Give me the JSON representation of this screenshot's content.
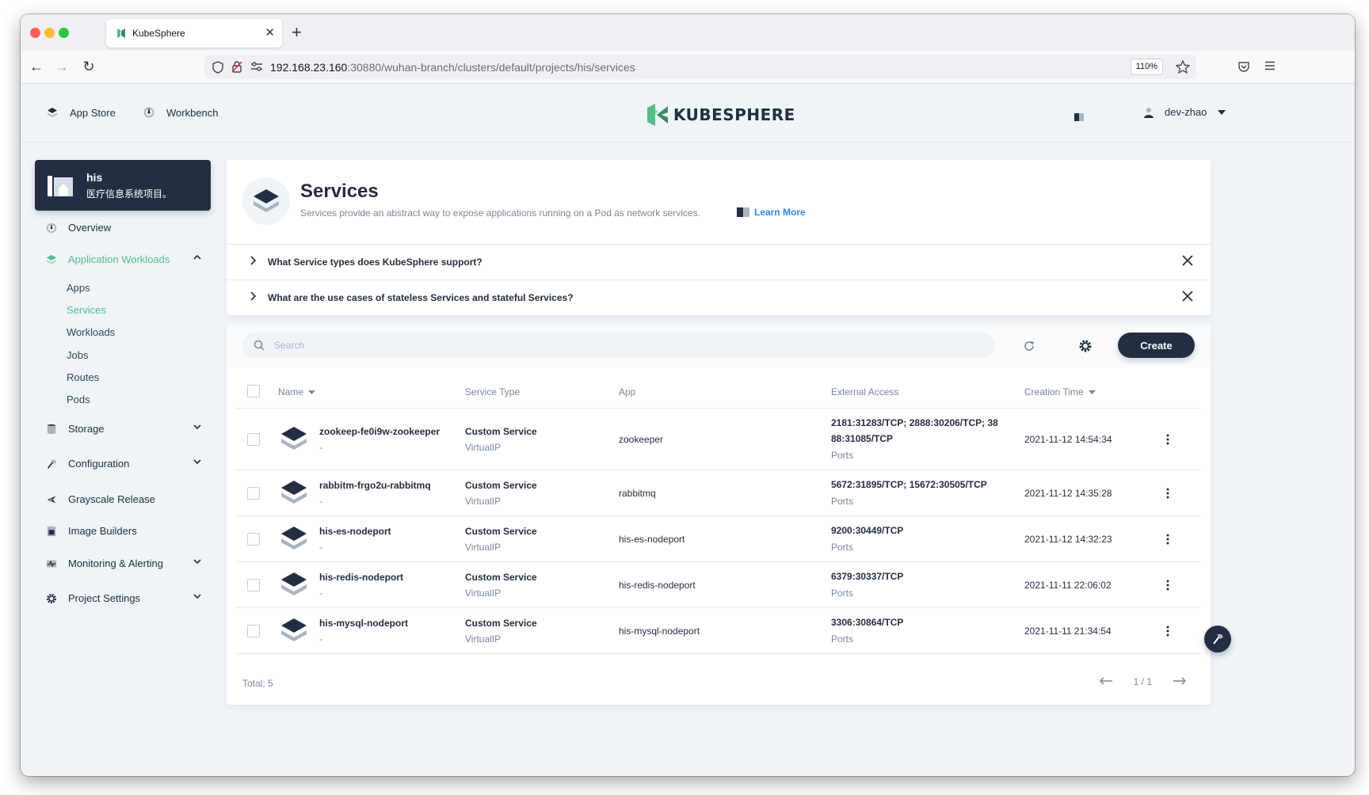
{
  "browser": {
    "tab_title": "KubeSphere",
    "url_host": "192.168.23.160",
    "url_rest": ":30880/wuhan-branch/clusters/default/projects/his/services",
    "zoom": "110%"
  },
  "header": {
    "app_store": "App Store",
    "workbench": "Workbench",
    "logo": "KUBESPHERE",
    "username": "dev-zhao"
  },
  "project": {
    "name": "his",
    "description": "医疗信息系统项目。"
  },
  "sidebar": {
    "overview": "Overview",
    "app_workloads": "Application Workloads",
    "sub_items": [
      "Apps",
      "Services",
      "Workloads",
      "Jobs",
      "Routes",
      "Pods"
    ],
    "storage": "Storage",
    "configuration": "Configuration",
    "grayscale": "Grayscale Release",
    "image_builders": "Image Builders",
    "monitoring": "Monitoring & Alerting",
    "project_settings": "Project Settings"
  },
  "banner": {
    "title": "Services",
    "description": "Services provide an abstract way to expose applications running on a Pod as network services.",
    "learn_more": "Learn More",
    "tips": [
      "What Service types does KubeSphere support?",
      "What are the use cases of stateless Services and stateful Services?"
    ]
  },
  "toolbar": {
    "search_placeholder": "Search",
    "create_label": "Create"
  },
  "table": {
    "columns": {
      "name": "Name",
      "service_type": "Service Type",
      "app": "App",
      "external_access": "External Access",
      "creation_time": "Creation Time"
    },
    "rows": [
      {
        "name": "zookeep-fe0i9w-zookeeper",
        "sub": "-",
        "type": "Custom Service",
        "type_sub": "VirtualIP",
        "app": "zookeeper",
        "ext": "2181:31283/TCP; 2888:30206/TCP; 3888:31085/TCP",
        "ext_sub": "Ports",
        "time": "2021-11-12 14:54:34"
      },
      {
        "name": "rabbitm-frgo2u-rabbitmq",
        "sub": "-",
        "type": "Custom Service",
        "type_sub": "VirtualIP",
        "app": "rabbitmq",
        "ext": "5672:31895/TCP; 15672:30505/TCP",
        "ext_sub": "Ports",
        "time": "2021-11-12 14:35:28"
      },
      {
        "name": "his-es-nodeport",
        "sub": "-",
        "type": "Custom Service",
        "type_sub": "VirtualIP",
        "app": "his-es-nodeport",
        "ext": "9200:30449/TCP",
        "ext_sub": "Ports",
        "time": "2021-11-12 14:32:23"
      },
      {
        "name": "his-redis-nodeport",
        "sub": "-",
        "type": "Custom Service",
        "type_sub": "VirtualIP",
        "app": "his-redis-nodeport",
        "ext": "6379:30337/TCP",
        "ext_sub": "Ports",
        "time": "2021-11-11 22:06:02"
      },
      {
        "name": "his-mysql-nodeport",
        "sub": "-",
        "type": "Custom Service",
        "type_sub": "VirtualIP",
        "app": "his-mysql-nodeport",
        "ext": "3306:30864/TCP",
        "ext_sub": "Ports",
        "time": "2021-11-11 21:34:54"
      }
    ]
  },
  "footer": {
    "total": "Total: 5",
    "page": "1 / 1"
  },
  "colors": {
    "accent": "#55bc8a",
    "dark": "#242e42",
    "muted": "#79879c",
    "background": "#eff4f9"
  }
}
